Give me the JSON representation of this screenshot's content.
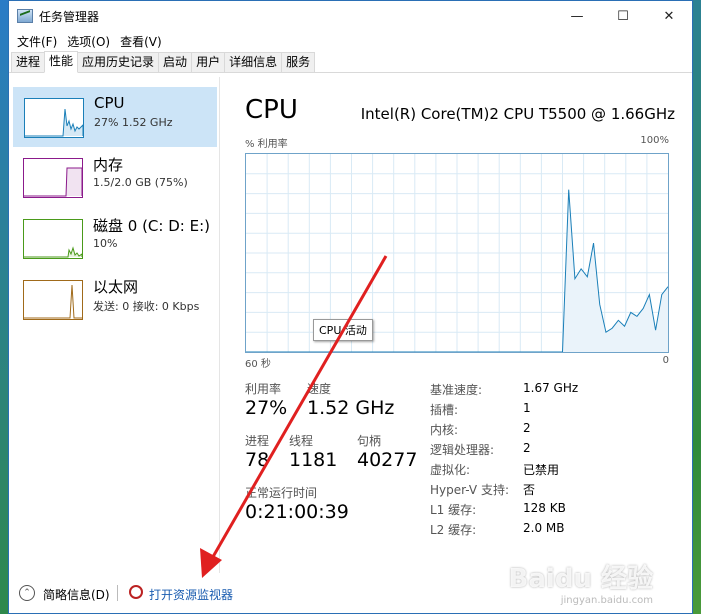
{
  "window": {
    "title": "任务管理器"
  },
  "menu": [
    "文件(F)",
    "选项(O)",
    "查看(V)"
  ],
  "tabs": [
    "进程",
    "性能",
    "应用历史记录",
    "启动",
    "用户",
    "详细信息",
    "服务"
  ],
  "sidebar": [
    {
      "name": "CPU",
      "sub": "27%  1.52 GHz",
      "color": "#1a7fb8"
    },
    {
      "name": "内存",
      "sub": "1.5/2.0 GB (75%)",
      "color": "#8b1a8b"
    },
    {
      "name": "磁盘 0 (C: D: E:)",
      "sub": "10%",
      "color": "#4a9a1a"
    },
    {
      "name": "以太网",
      "sub": "发送: 0 接收: 0 Kbps",
      "color": "#a06a1a"
    }
  ],
  "main": {
    "title": "CPU",
    "model": "Intel(R) Core(TM)2 CPU T5500 @ 1.66GHz",
    "y_label": "% 利用率",
    "y_max": "100%",
    "x_left": "60 秒",
    "x_right": "0",
    "tooltip": "CPU 活动"
  },
  "stats": {
    "util_label": "利用率",
    "util_value": "27%",
    "speed_label": "速度",
    "speed_value": "1.52 GHz",
    "proc_label": "进程",
    "proc_value": "78",
    "thread_label": "线程",
    "thread_value": "1181",
    "handle_label": "句柄",
    "handle_value": "40277",
    "uptime_label": "正常运行时间",
    "uptime_value": "0:21:00:39"
  },
  "info": [
    {
      "k": "基准速度:",
      "v": "1.67 GHz"
    },
    {
      "k": "插槽:",
      "v": "1"
    },
    {
      "k": "内核:",
      "v": "2"
    },
    {
      "k": "逻辑处理器:",
      "v": "2"
    },
    {
      "k": "虚拟化:",
      "v": "已禁用"
    },
    {
      "k": "Hyper-V 支持:",
      "v": "否"
    },
    {
      "k": "L1 缓存:",
      "v": "128 KB"
    },
    {
      "k": "L2 缓存:",
      "v": "2.0 MB"
    }
  ],
  "footer": {
    "fewer": "简略信息(D)",
    "resmon": "打开资源监视器"
  },
  "watermark": {
    "brand": "Baidu 经验",
    "url": "jingyan.baidu.com"
  },
  "cpu_history": [
    0,
    0,
    0,
    0,
    0,
    0,
    0,
    0,
    0,
    0,
    0,
    0,
    0,
    0,
    0,
    0,
    0,
    0,
    0,
    0,
    0,
    0,
    0,
    0,
    0,
    0,
    0,
    0,
    0,
    0,
    0,
    0,
    0,
    0,
    0,
    0,
    0,
    0,
    0,
    0,
    0,
    0,
    0,
    0,
    0,
    0,
    0,
    0,
    0,
    0,
    0,
    0,
    82,
    37,
    42,
    38,
    55,
    24,
    10,
    12,
    16,
    13,
    20,
    18,
    22,
    29,
    11,
    29,
    33
  ]
}
